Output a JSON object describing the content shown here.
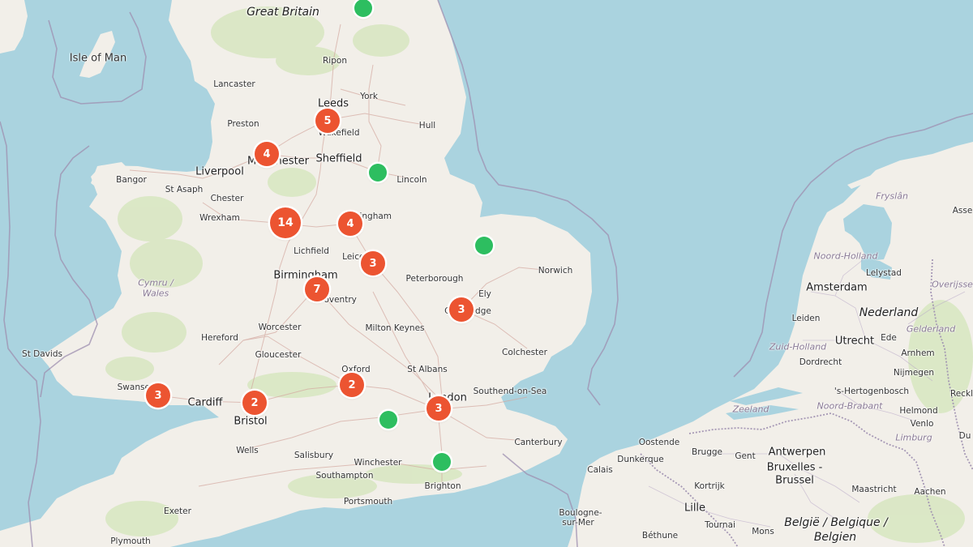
{
  "map": {
    "colors": {
      "water": "#aad3df",
      "land": "#f2efe9",
      "cluster": "#ec5431",
      "marker": "#2dbe60",
      "border": "#9e8fb0"
    },
    "labels": {
      "great_britain": "Great Britain",
      "isle_of_man": "Isle of Man",
      "cymru": "Cymru /",
      "wales": "Wales",
      "ripon": "Ripon",
      "lancaster": "Lancaster",
      "york": "York",
      "leeds": "Leeds",
      "preston": "Preston",
      "wakefield": "Wakefield",
      "hull": "Hull",
      "manchester": "Manchester",
      "sheffield": "Sheffield",
      "liverpool": "Liverpool",
      "bangor": "Bangor",
      "st_asaph": "St Asaph",
      "chester": "Chester",
      "lincoln": "Lincoln",
      "wrexham": "Wrexham",
      "nottingham": "Nottingham",
      "lichfield": "Lichfield",
      "leicester": "Leicester",
      "birmingham": "Birmingham",
      "peterborough": "Peterborough",
      "norwich": "Norwich",
      "coventry": "Coventry",
      "ely": "Ely",
      "cambridge": "Cambridge",
      "worcester": "Worcester",
      "milton_keynes": "Milton Keynes",
      "hereford": "Hereford",
      "st_davids": "St Davids",
      "gloucester": "Gloucester",
      "colchester": "Colchester",
      "oxford": "Oxford",
      "st_albans": "St Albans",
      "swansea": "Swansea",
      "cardiff": "Cardiff",
      "bristol": "Bristol",
      "london": "London",
      "southend": "Southend-on-Sea",
      "wells": "Wells",
      "salisbury": "Salisbury",
      "winchester": "Winchester",
      "canterbury": "Canterbury",
      "southampton": "Southampton",
      "brighton": "Brighton",
      "portsmouth": "Portsmouth",
      "exeter": "Exeter",
      "plymouth": "Plymouth",
      "fryslan": "Fryslân",
      "noord_holland": "Noord-Holland",
      "lelystad": "Lelystad",
      "amsterdam": "Amsterdam",
      "overijssel": "Overijssel",
      "leiden": "Leiden",
      "nederland": "Nederland",
      "utrecht": "Utrecht",
      "ede": "Ede",
      "gelderland": "Gelderland",
      "zuid_holland": "Zuid-Holland",
      "arnhem": "Arnhem",
      "dordrecht": "Dordrecht",
      "nijmegen": "Nijmegen",
      "hertogenbosch": "'s-Hertogenbosch",
      "noord_brabant": "Noord-Brabant",
      "zeeland": "Zeeland",
      "helmond": "Helmond",
      "venlo": "Venlo",
      "limburg": "Limburg",
      "oostende": "Oostende",
      "brugge": "Brugge",
      "gent": "Gent",
      "antwerpen": "Antwerpen",
      "bruxelles": "Bruxelles -",
      "brussel": "Brussel",
      "dunkerque": "Dunkerque",
      "calais": "Calais",
      "kortrijk": "Kortrijk",
      "maastricht": "Maastricht",
      "aachen": "Aachen",
      "lille": "Lille",
      "boulogne_1": "Boulogne-",
      "boulogne_2": "sur-Mer",
      "tournai": "Tournai",
      "mons": "Mons",
      "belgie": "België / Belgique /",
      "belgien": "Belgien",
      "bethune": "Béthune",
      "assen": "Asse",
      "reckl": "Reckl",
      "du": "Du"
    },
    "clusters": [
      {
        "id": "leeds",
        "count": "5"
      },
      {
        "id": "manchester",
        "count": "4"
      },
      {
        "id": "stoke",
        "count": "14"
      },
      {
        "id": "nottingham",
        "count": "4"
      },
      {
        "id": "leicester",
        "count": "3"
      },
      {
        "id": "birmingham",
        "count": "7"
      },
      {
        "id": "cambridge",
        "count": "3"
      },
      {
        "id": "oxford",
        "count": "2"
      },
      {
        "id": "bristol",
        "count": "2"
      },
      {
        "id": "swansea",
        "count": "3"
      },
      {
        "id": "london",
        "count": "3"
      }
    ],
    "markers": [
      {
        "id": "north-york"
      },
      {
        "id": "gainsborough"
      },
      {
        "id": "kings-lynn"
      },
      {
        "id": "reading"
      },
      {
        "id": "crawley"
      }
    ]
  }
}
